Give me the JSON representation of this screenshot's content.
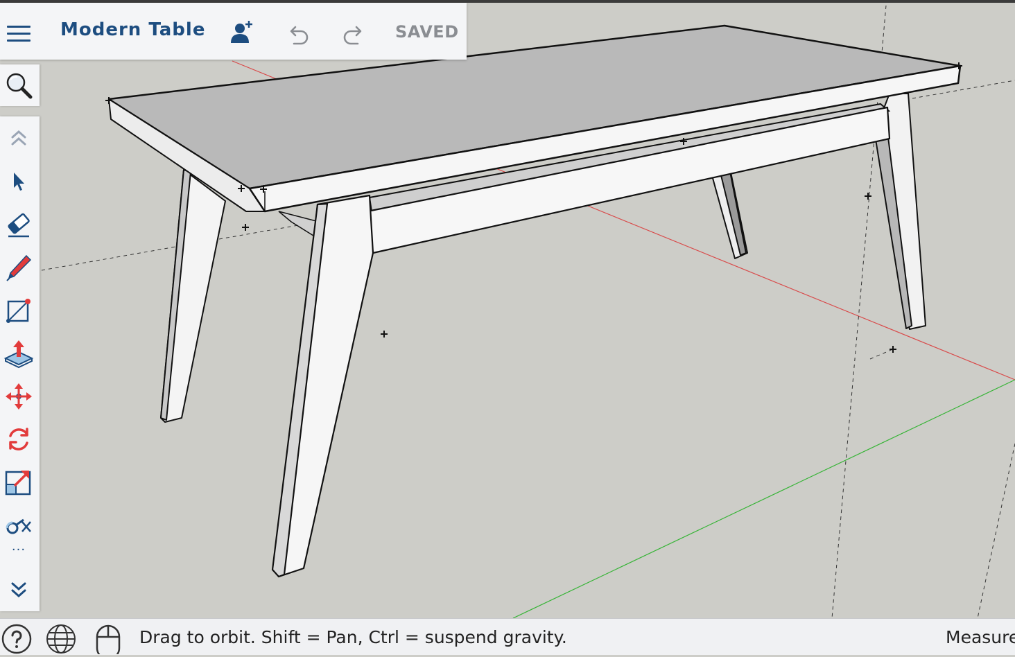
{
  "header": {
    "title": "Modern Table",
    "status": "SAVED",
    "accent_color": "#1d4d80",
    "icons": [
      "menu-icon",
      "add-collaborator-icon",
      "undo-icon",
      "redo-icon"
    ]
  },
  "toolbar": {
    "tools": [
      "search-icon",
      "collapse-up-icon",
      "select-icon",
      "eraser-icon",
      "pencil-icon",
      "rectangle-icon",
      "push-pull-icon",
      "move-icon",
      "rotate-icon",
      "scale-icon",
      "tape-measure-icon",
      "more-icon",
      "expand-down-icon"
    ],
    "more_label": "···"
  },
  "statusbar": {
    "message": "Drag to orbit. Shift = Pan, Ctrl = suspend gravity.",
    "measure_label": "Measure",
    "icons": [
      "help-icon",
      "globe-icon",
      "mouse-icon"
    ]
  },
  "scene": {
    "background": "#cdcdc8",
    "axis_colors": {
      "red": "#d94a4a",
      "green": "#36b436"
    }
  }
}
